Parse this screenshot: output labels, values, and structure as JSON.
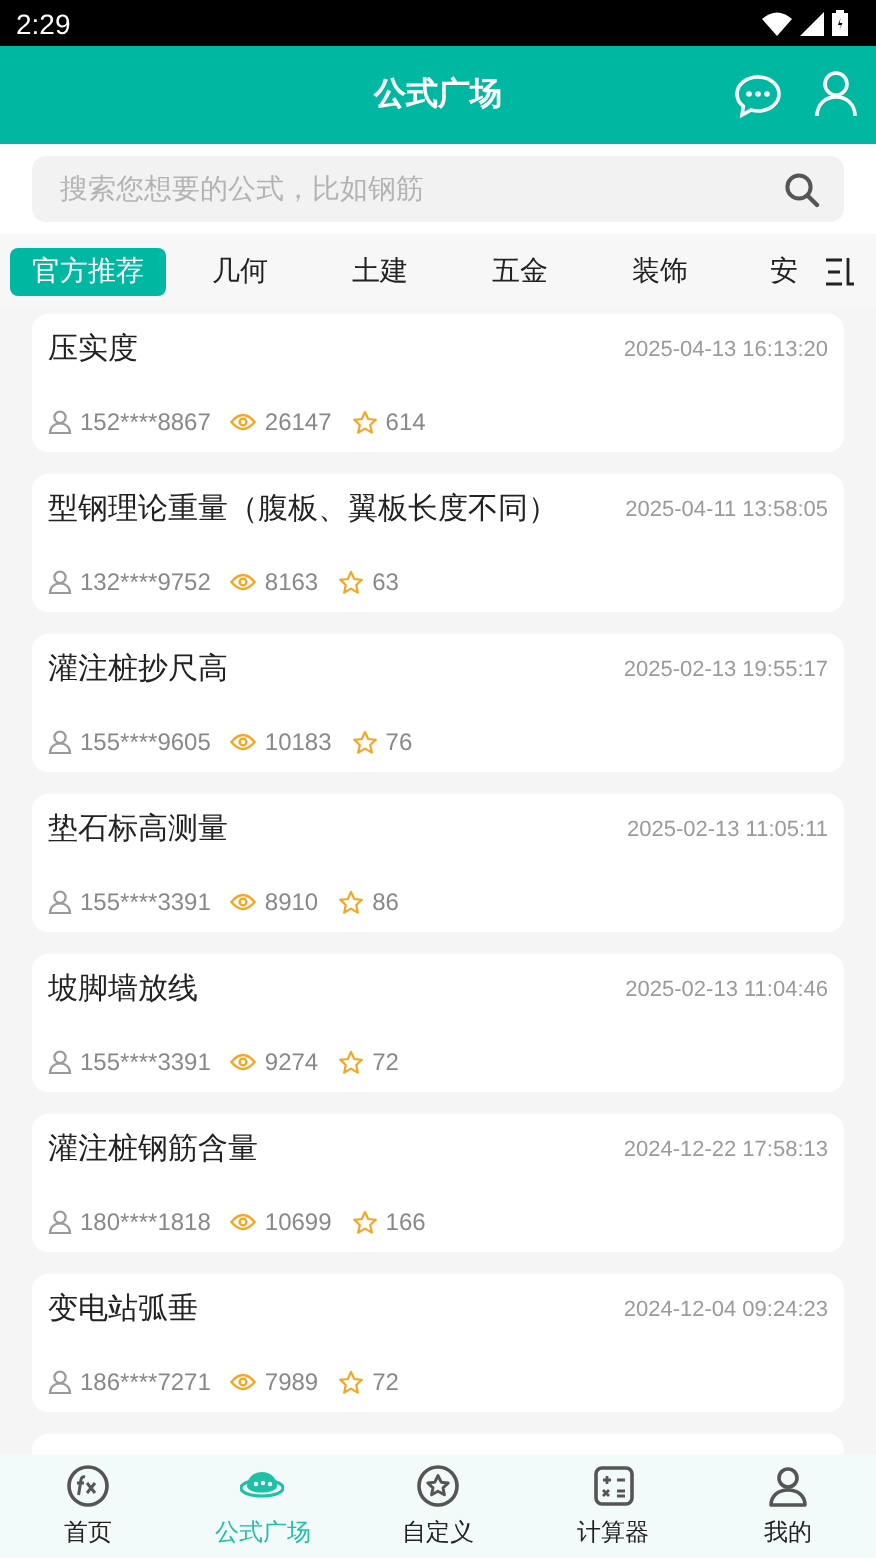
{
  "status_bar": {
    "time": "2:29"
  },
  "header": {
    "title": "公式广场"
  },
  "search": {
    "placeholder": "搜索您想要的公式，比如钢筋"
  },
  "tabs": [
    {
      "label": "官方推荐",
      "selected": true
    },
    {
      "label": "几何",
      "selected": false
    },
    {
      "label": "土建",
      "selected": false
    },
    {
      "label": "五金",
      "selected": false
    },
    {
      "label": "装饰",
      "selected": false
    },
    {
      "label": "安",
      "selected": false
    }
  ],
  "formulas": [
    {
      "title": "压实度",
      "date": "2025-04-13 16:13:20",
      "author": "152****8867",
      "views": "26147",
      "favorites": "614"
    },
    {
      "title": "型钢理论重量（腹板、翼板长度不同）",
      "date": "2025-04-11 13:58:05",
      "author": "132****9752",
      "views": "8163",
      "favorites": "63"
    },
    {
      "title": "灌注桩抄尺高",
      "date": "2025-02-13 19:55:17",
      "author": "155****9605",
      "views": "10183",
      "favorites": "76"
    },
    {
      "title": "垫石标高测量",
      "date": "2025-02-13 11:05:11",
      "author": "155****3391",
      "views": "8910",
      "favorites": "86"
    },
    {
      "title": "坡脚墙放线",
      "date": "2025-02-13 11:04:46",
      "author": "155****3391",
      "views": "9274",
      "favorites": "72"
    },
    {
      "title": "灌注桩钢筋含量",
      "date": "2024-12-22 17:58:13",
      "author": "180****1818",
      "views": "10699",
      "favorites": "166"
    },
    {
      "title": "变电站弧垂",
      "date": "2024-12-04 09:24:23",
      "author": "186****7271",
      "views": "7989",
      "favorites": "72"
    }
  ],
  "bottom_nav": [
    {
      "label": "首页",
      "selected": false
    },
    {
      "label": "公式广场",
      "selected": true
    },
    {
      "label": "自定义",
      "selected": false
    },
    {
      "label": "计算器",
      "selected": false
    },
    {
      "label": "我的",
      "selected": false
    }
  ]
}
